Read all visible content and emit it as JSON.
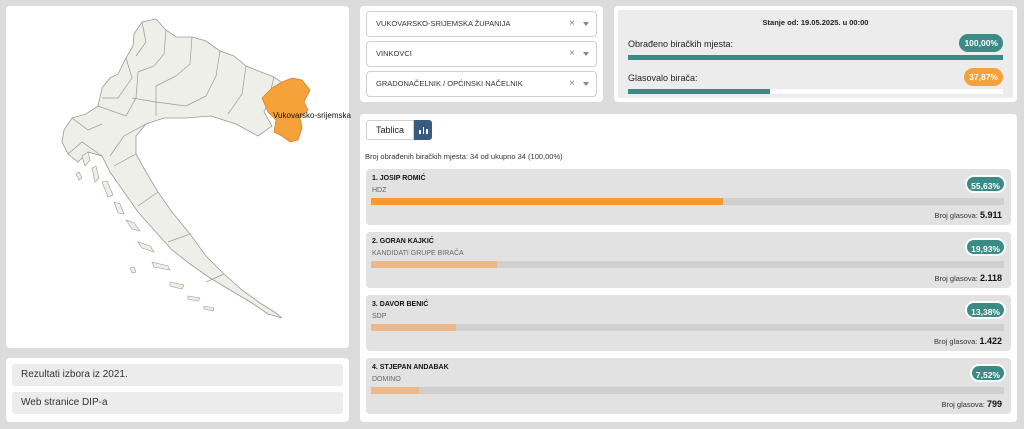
{
  "map": {
    "highlighted_region": "Vukovarsko-srijemska",
    "highlight_color": "#f7a13a"
  },
  "links": [
    {
      "label": "Rezultati izbora iz 2021."
    },
    {
      "label": "Web stranice DIP-a"
    }
  ],
  "filters": [
    {
      "value": "VUKOVARSKO-SRIJEMSKA ŽUPANIJA"
    },
    {
      "value": "VINKOVCI"
    },
    {
      "value": "GRADONAČELNIK / OPĆINSKI NAČELNIK"
    }
  ],
  "status": {
    "title": "Stanje od: 19.05.2025. u 00:00",
    "processed_label": "Obrađeno biračkih mjesta:",
    "processed_value": "100,00%",
    "processed_fraction": 1.0,
    "turnout_label": "Glasovalo birača:",
    "turnout_value": "37,87%",
    "turnout_fraction": 0.3787,
    "teal": "#3a8a86",
    "orange": "#f7a13a"
  },
  "results": {
    "tab_table_label": "Tablica",
    "processed_text": "Broj obrađenih biračkih mjesta: 34 od ukupno 34 (100,00%)",
    "votes_label": "Broj glasova:",
    "candidates": [
      {
        "name": "1. JOSIP ROMIĆ",
        "party": "HDZ",
        "percent": "55,63%",
        "share": 0.5563,
        "votes": "5.911",
        "color": "#f7992e"
      },
      {
        "name": "2. GORAN KAJKIĆ",
        "party": "KANDIDATI GRUPE BIRAČA",
        "percent": "19,93%",
        "share": 0.1993,
        "votes": "2.118",
        "color": "#ebb98b"
      },
      {
        "name": "3. DAVOR BENIĆ",
        "party": "SDP",
        "percent": "13,38%",
        "share": 0.1338,
        "votes": "1.422",
        "color": "#ebb98b"
      },
      {
        "name": "4. STJEPAN ANDABAK",
        "party": "DOMINO",
        "percent": "7,52%",
        "share": 0.0752,
        "votes": "799",
        "color": "#ebb98b"
      }
    ]
  }
}
